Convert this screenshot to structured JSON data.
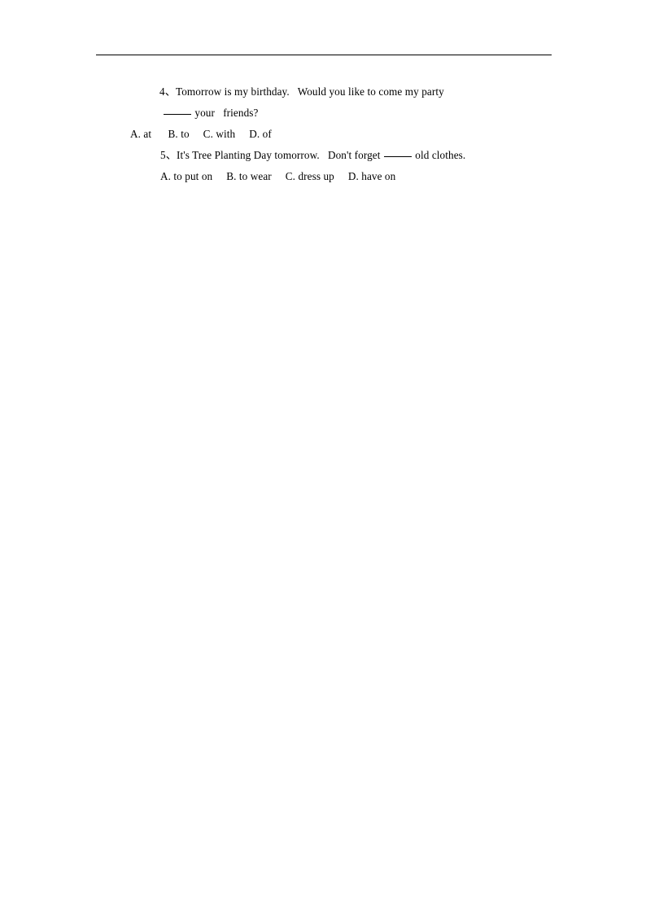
{
  "document": {
    "page_background": "#ffffff",
    "text_color": "#000000",
    "header_rule": {
      "present": true,
      "color": "#000000"
    }
  },
  "questions": [
    {
      "number": "4、",
      "stem_line1": "Tomorrow is my birthday.",
      "stem_line1_cont": "Would you like to come my party",
      "stem_line2_after_blank": "your",
      "stem_line2_end": "friends?",
      "options": [
        "A. at",
        "B. to",
        "C. with",
        "D. of"
      ],
      "options_line": "A. at      B. to      C. with      D. of"
    },
    {
      "number": "5、",
      "stem_part1": "It's Tree Planting Day tomorrow.",
      "stem_part2": "Don't forget",
      "stem_part3": "old clothes.",
      "options": [
        "A. to put on",
        "B. to wear",
        "C. dress up",
        "D. have on"
      ],
      "options_line": "A. to put on     B. to wear     C. dress up     D. have on"
    }
  ]
}
